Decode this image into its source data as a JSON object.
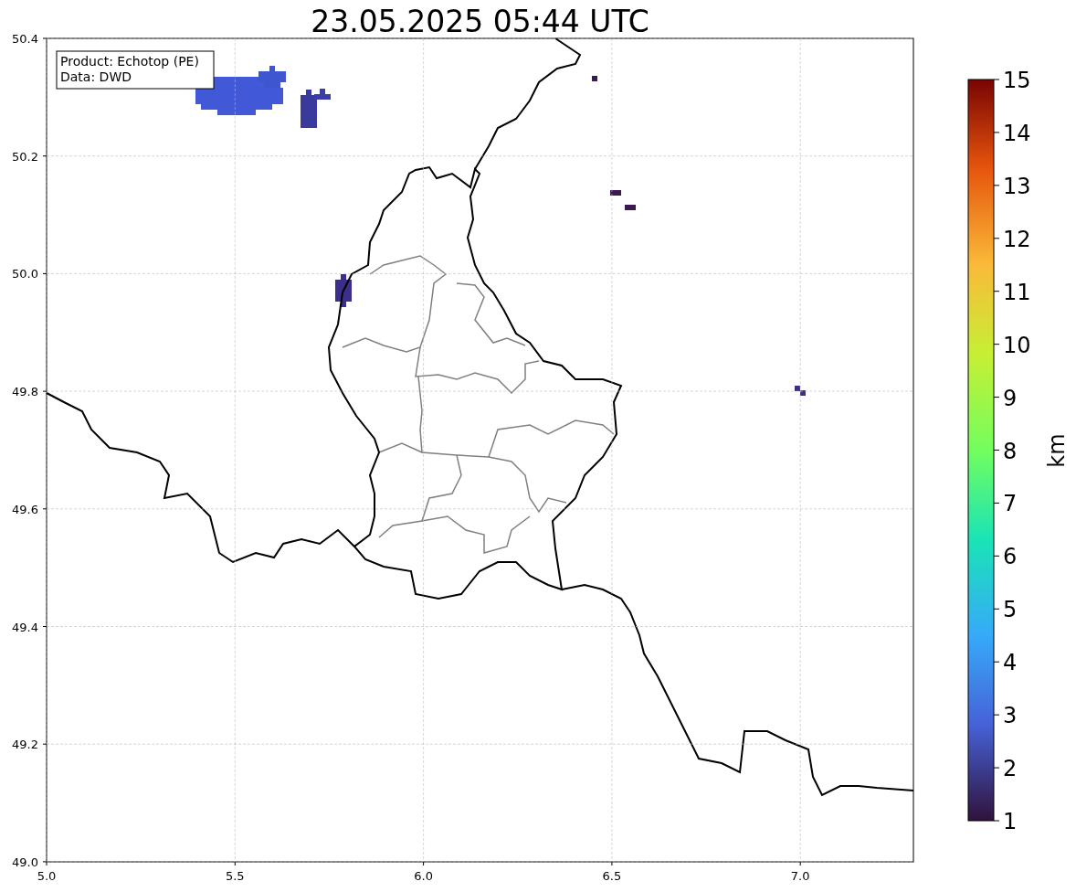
{
  "title": "23.05.2025 05:44 UTC",
  "info_box": [
    "Product: Echotop (PE)",
    "Data: DWD"
  ],
  "x_ticks": [
    "5.0",
    "5.5",
    "6.0",
    "6.5",
    "7.0"
  ],
  "y_ticks": [
    "50.4",
    "50.2",
    "50.0",
    "49.8",
    "49.6",
    "49.4",
    "49.2",
    "49.0"
  ],
  "colorbar": {
    "label": "km",
    "ticks": [
      "15",
      "14",
      "13",
      "12",
      "11",
      "10",
      "9",
      "8",
      "7",
      "6",
      "5",
      "4",
      "3",
      "2",
      "1"
    ]
  }
}
